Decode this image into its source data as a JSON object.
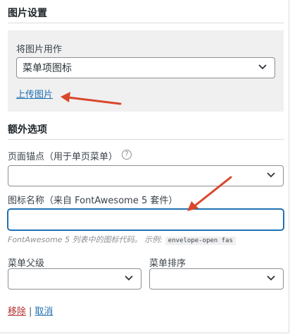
{
  "image_settings": {
    "title": "图片设置",
    "use_image_as_label": "将图片用作",
    "use_image_as_value": "菜单项图标",
    "upload_link": "上传图片"
  },
  "extra_options": {
    "title": "额外选项",
    "anchor_label": "页面锚点（用于单页菜单）",
    "anchor_help_icon": "?",
    "anchor_value": "",
    "icon_name_label": "图标名称（来自 FontAwesome 5 套件）",
    "icon_name_value": "",
    "icon_help_text": "FontAwesome 5 列表中的图标代码。 示例:",
    "icon_help_example": "envelope-open fas",
    "parent_label": "菜单父级",
    "parent_value": "",
    "order_label": "菜单排序",
    "order_value": ""
  },
  "actions": {
    "remove": "移除",
    "separator": "|",
    "cancel": "取消"
  },
  "colors": {
    "annotation_arrow": "#d9472b",
    "link": "#2271b1",
    "remove": "#b32d2e"
  }
}
